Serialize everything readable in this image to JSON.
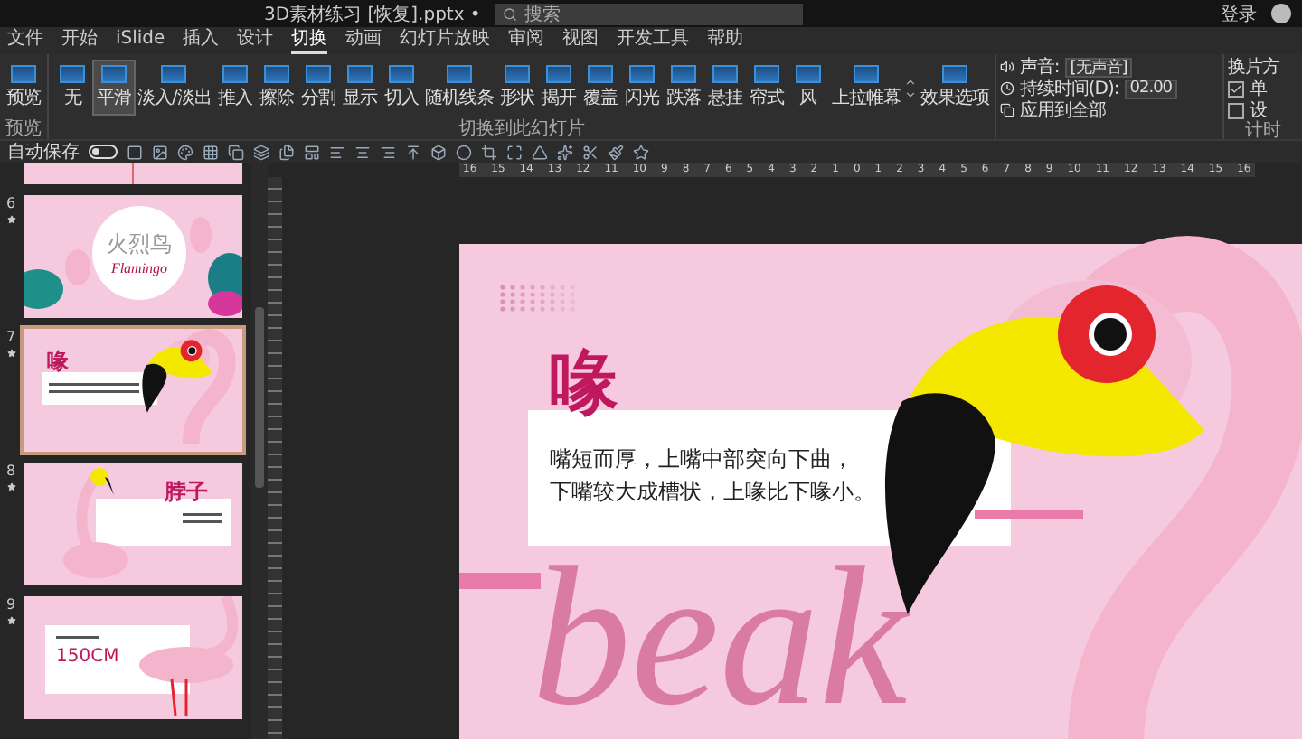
{
  "window": {
    "title": "3D素材练习 [恢复].pptx •",
    "search": {
      "placeholder": "搜索"
    },
    "account": "登录"
  },
  "menu": [
    {
      "label": "文件",
      "selected": false
    },
    {
      "label": "开始",
      "selected": false
    },
    {
      "label": "iSlide",
      "selected": false
    },
    {
      "label": "插入",
      "selected": false
    },
    {
      "label": "设计",
      "selected": false
    },
    {
      "label": "切换",
      "selected": true
    },
    {
      "label": "动画",
      "selected": false
    },
    {
      "label": "幻灯片放映",
      "selected": false
    },
    {
      "label": "审阅",
      "selected": false
    },
    {
      "label": "视图",
      "selected": false
    },
    {
      "label": "开发工具",
      "selected": false
    },
    {
      "label": "帮助",
      "selected": false
    }
  ],
  "ribbon": {
    "preview": "预览",
    "preview_group": "预览",
    "transitions_group": "切换到此幻灯片",
    "timing_group": "计时",
    "transitions": [
      {
        "label": "无",
        "selected": false
      },
      {
        "label": "平滑",
        "selected": true
      },
      {
        "label": "淡入/淡出",
        "selected": false
      },
      {
        "label": "推入",
        "selected": false
      },
      {
        "label": "擦除",
        "selected": false
      },
      {
        "label": "分割",
        "selected": false
      },
      {
        "label": "显示",
        "selected": false
      },
      {
        "label": "切入",
        "selected": false
      },
      {
        "label": "随机线条",
        "selected": false
      },
      {
        "label": "形状",
        "selected": false
      },
      {
        "label": "揭开",
        "selected": false
      },
      {
        "label": "覆盖",
        "selected": false
      },
      {
        "label": "闪光",
        "selected": false
      },
      {
        "label": "跌落",
        "selected": false
      },
      {
        "label": "悬挂",
        "selected": false
      },
      {
        "label": "帘式",
        "selected": false
      },
      {
        "label": "风",
        "selected": false
      },
      {
        "label": "上拉帷幕",
        "selected": false
      }
    ],
    "effect_options": "效果选项",
    "sound_label": "声音:",
    "sound_value": "[无声音]",
    "duration_label": "持续时间(D):",
    "duration_value": "02.00",
    "apply_all": "应用到全部",
    "advance_label": "换片方",
    "advance_options": [
      {
        "label": "单",
        "checked": true
      },
      {
        "label": "设",
        "checked": false
      }
    ]
  },
  "quick_access": {
    "autosave_label": "自动保存",
    "autosave_on": false
  },
  "ruler": [
    "16",
    "15",
    "14",
    "13",
    "12",
    "11",
    "10",
    "9",
    "8",
    "7",
    "6",
    "5",
    "4",
    "3",
    "2",
    "1",
    "0",
    "1",
    "2",
    "3",
    "4",
    "5",
    "6",
    "7",
    "8",
    "9",
    "10",
    "11",
    "12",
    "13",
    "14",
    "15",
    "16"
  ],
  "thumbnails": [
    {
      "kind": "partial",
      "selected": false,
      "animated": false
    },
    {
      "kind": "title",
      "number": "6",
      "title": "火烈鸟",
      "subtitle": "Flamingo",
      "selected": false,
      "animated": true
    },
    {
      "kind": "beak",
      "number": "7",
      "title": "喙",
      "selected": true,
      "animated": true
    },
    {
      "kind": "neck",
      "number": "8",
      "title": "脖子",
      "selected": false,
      "animated": true
    },
    {
      "kind": "height",
      "number": "9",
      "title": "150CM",
      "selected": false,
      "animated": true
    }
  ],
  "slide": {
    "heading": "喙",
    "lines": [
      "嘴短而厚，上嘴中部突向下曲，",
      "下嘴较大成槽状，上喙比下喙小。"
    ],
    "script_text": "beak"
  }
}
